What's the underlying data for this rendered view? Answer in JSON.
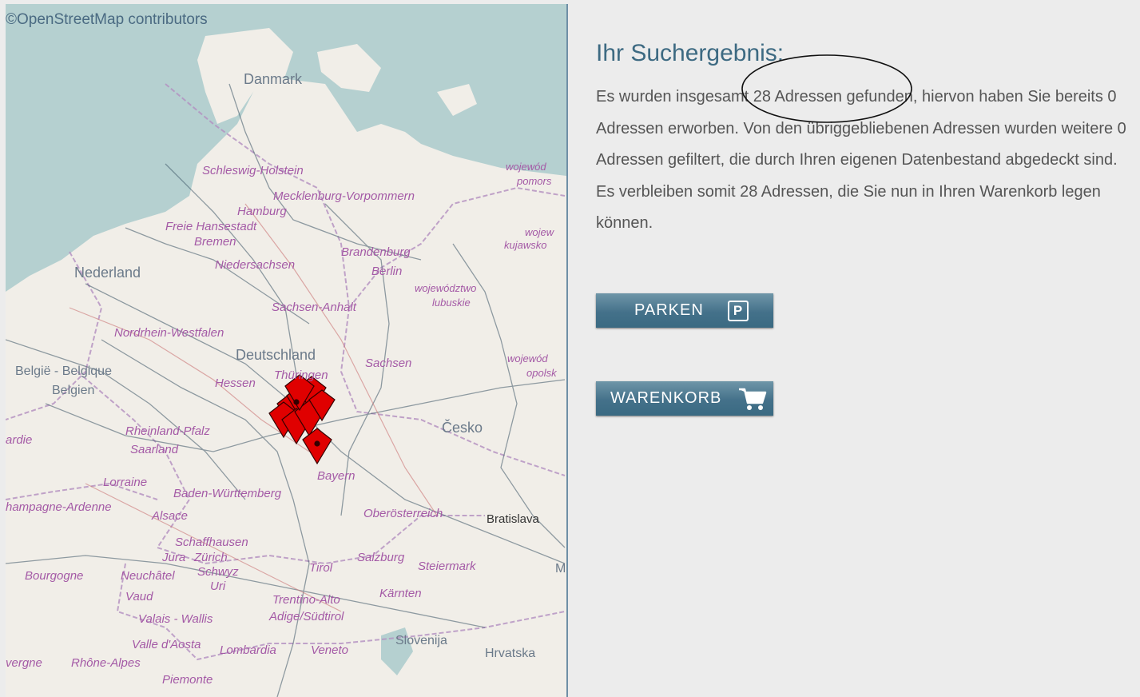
{
  "map": {
    "attribution": "©OpenStreetMap contributors",
    "labels": {
      "danmark": "Danmark",
      "schleswig": "Schleswig-Holstein",
      "mecklenburg": "Mecklenburg-Vorpommern",
      "hamburg": "Hamburg",
      "freie": "Freie Hansestadt",
      "bremen": "Bremen",
      "niedersachsen": "Niedersachsen",
      "brandenburg": "Brandenburg",
      "berlin": "Berlin",
      "nederland": "Nederland",
      "sachsen_anhalt": "Sachsen-Anhalt",
      "nordrhein": "Nordrhein-Westfalen",
      "deutschland": "Deutschland",
      "sachsen": "Sachsen",
      "thueringen": "Thüringen",
      "hessen": "Hessen",
      "belgie": "België - Belgique",
      "belgien": "Belgien",
      "rheinland": "Rheinland-Pfalz",
      "saarland": "Saarland",
      "cesko": "Česko",
      "bayern": "Bayern",
      "lorraine": "Lorraine",
      "baden": "Baden-Württemberg",
      "champagne": "hampagne-Ardenne",
      "alsace": "Alsace",
      "oberoesterreich": "Oberösterreich",
      "bratislava": "Bratislava",
      "schaffhausen": "Schaffhausen",
      "jura": "Jura",
      "zuerich": "Zürich",
      "bourgogne": "Bourgogne",
      "neuchatel": "Neuchâtel",
      "schwyz": "Schwyz",
      "uri": "Uri",
      "tirol": "Tirol",
      "salzburg": "Salzburg",
      "steiermark": "Steiermark",
      "vaud": "Vaud",
      "trentino": "Trentino-Alto",
      "adige": "Adige/Südtirol",
      "kaernten": "Kärnten",
      "valais": "Valais - Wallis",
      "valle": "Valle d'Aosta",
      "lombardia": "Lombardia",
      "veneto": "Veneto",
      "slovenija": "Slovenija",
      "rhone": "Rhône-Alpes",
      "hrvatska": "Hrvatska",
      "piemonte": "Piemonte",
      "wojewod1": "wojewód",
      "pomors": "pomors",
      "wojew2": "wojew",
      "kujawsko": "kujawsko",
      "wojewodztwo": "województwo",
      "lubuskie": "lubuskie",
      "wojewod3": "wojewód",
      "opolsk": "opolsk",
      "ardie": "ardie",
      "vergne": "vergne",
      "m": "M"
    }
  },
  "result": {
    "title": "Ihr Suchergebnis:",
    "text": "Es wurden insgesamt 28 Adressen gefunden, hiervon haben Sie bereits 0 Adressen erworben. Von den übriggebliebenen Adressen wurden weitere 0 Adressen gefiltert, die durch Ihren eigenen Datenbestand abgedeckt sind. Es verbleiben somit 28 Adressen, die Sie nun in Ihren Warenkorb legen können."
  },
  "buttons": {
    "parken_label": "PARKEN",
    "parken_icon": "P",
    "warenkorb_label": "WARENKORB"
  },
  "colors": {
    "accent": "#3d6a82",
    "marker": "#e00000"
  }
}
